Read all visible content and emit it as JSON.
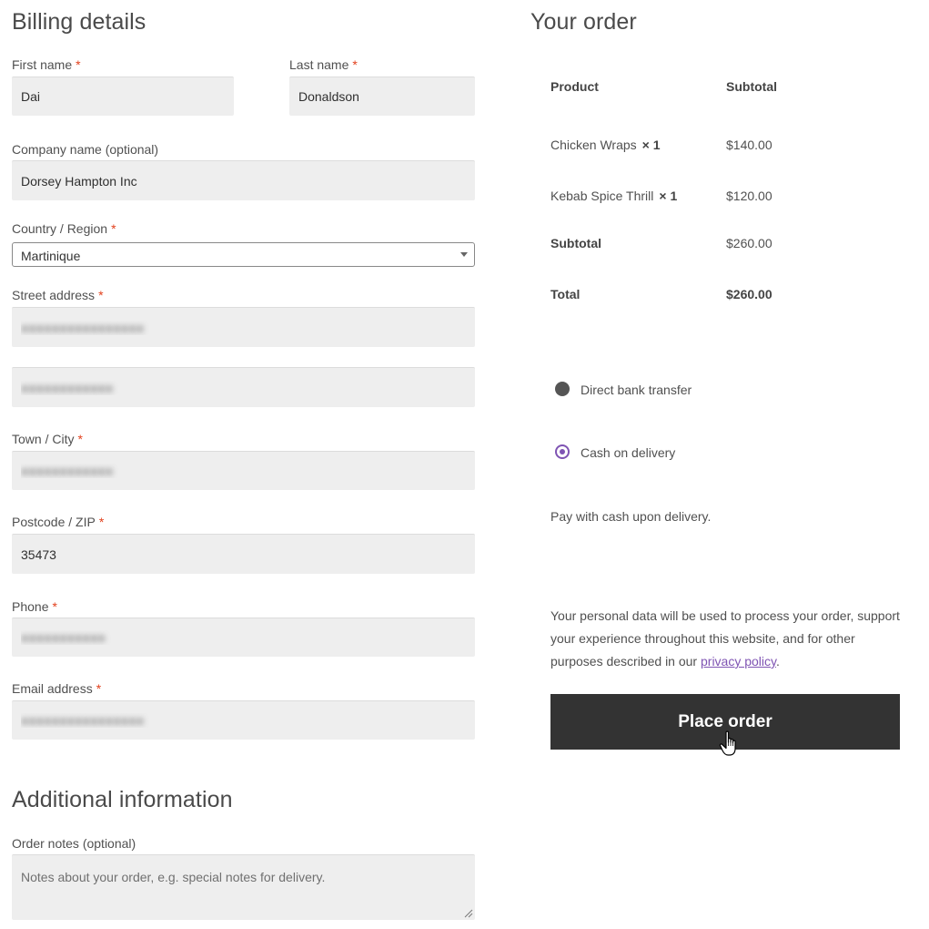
{
  "billing": {
    "heading": "Billing details",
    "first_name": {
      "label": "First name",
      "value": "Dai"
    },
    "last_name": {
      "label": "Last name",
      "value": "Donaldson"
    },
    "company": {
      "label": "Company name (optional)",
      "value": "Dorsey Hampton Inc"
    },
    "country": {
      "label": "Country / Region",
      "value": "Martinique"
    },
    "street": {
      "label": "Street address",
      "line1": "●●●●●●●●●●●●●●●●",
      "line2": "●●●●●●●●●●●●"
    },
    "town": {
      "label": "Town / City",
      "value": "●●●●●●●●●●●●"
    },
    "postcode": {
      "label": "Postcode / ZIP",
      "value": "35473"
    },
    "phone": {
      "label": "Phone",
      "value": "●●●●●●●●●●●"
    },
    "email": {
      "label": "Email address",
      "value": "●●●●●●●●●●●●●●●●"
    },
    "required_mark": "*"
  },
  "additional": {
    "heading": "Additional information",
    "notes_label": "Order notes (optional)",
    "notes_placeholder": "Notes about your order, e.g. special notes for delivery."
  },
  "order": {
    "heading": "Your order",
    "col_product": "Product",
    "col_subtotal": "Subtotal",
    "items": [
      {
        "name": "Chicken Wraps",
        "qty": "× 1",
        "price": "$140.00"
      },
      {
        "name": "Kebab Spice Thrill",
        "qty": "× 1",
        "price": "$120.00"
      }
    ],
    "subtotal_label": "Subtotal",
    "subtotal_value": "$260.00",
    "total_label": "Total",
    "total_value": "$260.00"
  },
  "payment": {
    "options": [
      {
        "label": "Direct bank transfer",
        "selected": false
      },
      {
        "label": "Cash on delivery",
        "selected": true
      }
    ],
    "description": "Pay with cash upon delivery."
  },
  "privacy": {
    "text_before": "Your personal data will be used to process your order, support your experience throughout this website, and for other purposes described in our ",
    "link": "privacy policy",
    "text_after": "."
  },
  "place_order_label": "Place order",
  "colors": {
    "accent": "#7f54b3",
    "required": "#e2401c",
    "button": "#333333",
    "field": "#eeeeee"
  }
}
